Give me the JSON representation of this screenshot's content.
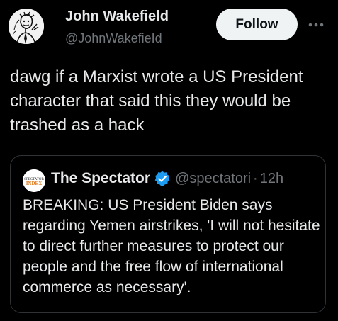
{
  "author": {
    "name": "John Wakefield",
    "handle": "@JohnWakefieId",
    "avatar_icon": "portrait-sketch-avatar"
  },
  "follow_label": "Follow",
  "more_icon": "more-horizontal-icon",
  "tweet": {
    "text": "dawg if a Marxist wrote a US President character that said this they would be trashed as a hack"
  },
  "quote": {
    "avatar_text": "SPECTATOR INDEX",
    "name": "The Spectator",
    "verified_icon": "verified-badge-icon",
    "verified_color": "#1d9bf0",
    "handle": "@spectatori",
    "separator": "·",
    "time": "12h",
    "text": "BREAKING: US President Biden says regarding Yemen airstrikes, 'I will not hesitate to direct further measures to protect our people and the free flow of international commerce as necessary'."
  },
  "colors": {
    "background": "#000000",
    "text_primary": "#e7e9ea",
    "text_secondary": "#71767b",
    "border": "#2f3336",
    "follow_bg": "#eff3f4"
  }
}
